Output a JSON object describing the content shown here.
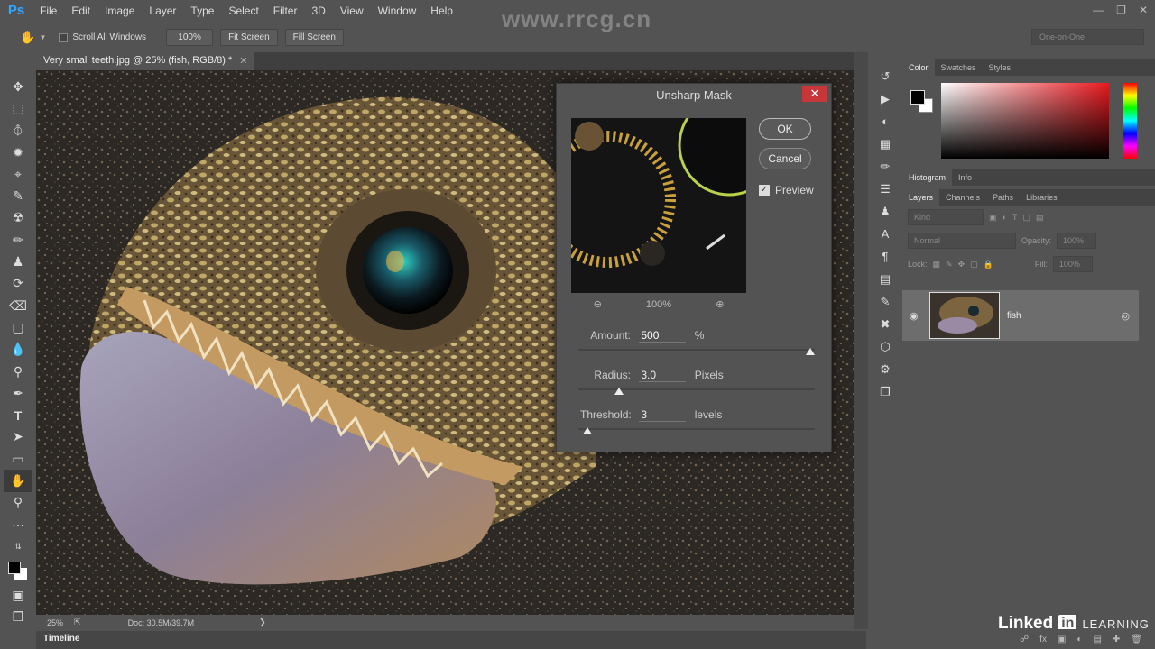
{
  "app": {
    "logo": "Ps",
    "menu": [
      "File",
      "Edit",
      "Image",
      "Layer",
      "Type",
      "Select",
      "Filter",
      "3D",
      "View",
      "Window",
      "Help"
    ]
  },
  "options_bar": {
    "scroll_all": "Scroll All Windows",
    "zoom": "100%",
    "fit_screen": "Fit Screen",
    "fill_screen": "Fill Screen",
    "workspace": "One-on-One"
  },
  "document": {
    "tab_title": "Very small teeth.jpg @ 25% (fish, RGB/8) *",
    "status_zoom": "25%",
    "status_doc": "Doc: 30.5M/39.7M"
  },
  "timeline": {
    "label": "Timeline"
  },
  "dialog": {
    "title": "Unsharp Mask",
    "ok": "OK",
    "cancel": "Cancel",
    "preview_label": "Preview",
    "preview_checked": true,
    "preview_zoom": "100%",
    "amount": {
      "label": "Amount:",
      "value": "500",
      "unit": "%",
      "slider_fraction": 1.0
    },
    "radius": {
      "label": "Radius:",
      "value": "3.0",
      "unit": "Pixels",
      "slider_fraction": 0.16
    },
    "threshold": {
      "label": "Threshold:",
      "value": "3",
      "unit": "levels",
      "slider_fraction": 0.02
    }
  },
  "panels": {
    "color_tabs": [
      "Color",
      "Swatches",
      "Styles"
    ],
    "info_tabs": [
      "Histogram",
      "Info"
    ],
    "layer_tabs": [
      "Layers",
      "Channels",
      "Paths",
      "Libraries"
    ],
    "kind": "Kind",
    "blend_mode": "Normal",
    "opacity_label": "Opacity:",
    "opacity_value": "100%",
    "lock_label": "Lock:",
    "fill_label": "Fill:",
    "fill_value": "100%",
    "layer_name": "fish",
    "color_fg": "#000000",
    "color_bg": "#ffffff",
    "hue_accent": "#e8191f"
  },
  "watermark": "www.rrcg.cn",
  "brand": {
    "linked": "Linked",
    "in": "in",
    "learning": "LEARNING"
  }
}
